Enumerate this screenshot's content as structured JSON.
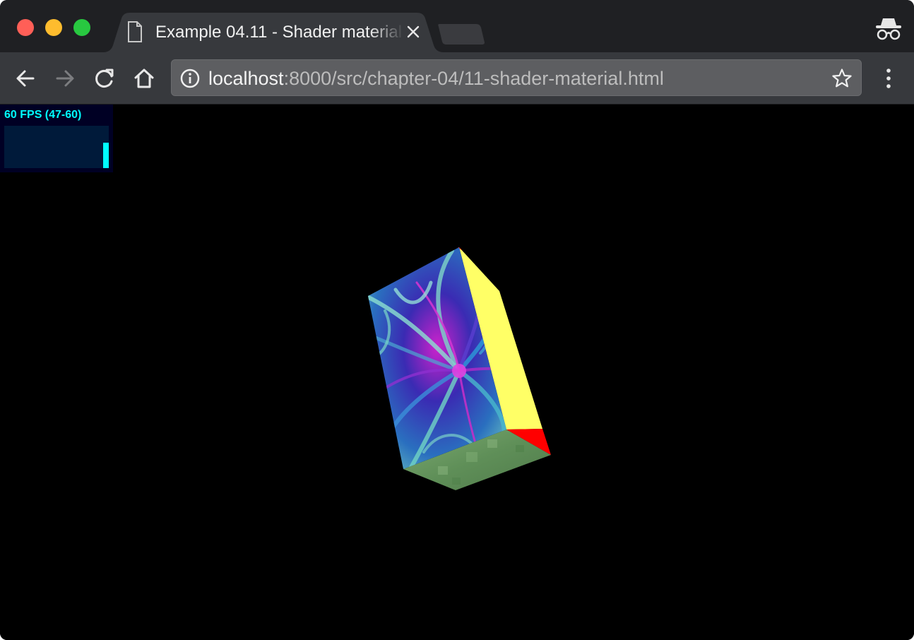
{
  "window": {
    "tab": {
      "title": "Example 04.11 - Shader material",
      "close_icon": "close-icon",
      "doc_icon": "document-icon"
    },
    "incognito_icon": "incognito-icon"
  },
  "toolbar": {
    "back_icon": "arrow-left-icon",
    "forward_icon": "arrow-right-icon",
    "reload_icon": "reload-icon",
    "home_icon": "home-icon",
    "omnibox": {
      "info_icon": "info-icon",
      "url_host": "localhost",
      "url_rest": ":8000/src/chapter-04/11-shader-material.html",
      "bookmark_icon": "star-icon"
    },
    "menu_icon": "three-dots-vertical-icon"
  },
  "stats": {
    "label": "60 FPS (47-60)",
    "fps_level": 0.6,
    "color": "#00ffff"
  },
  "scene": {
    "object": "rotating-box",
    "colors": {
      "background": "#000000",
      "side_face": "#ffff66",
      "corner": "#ff0000",
      "bottom_face": "#6a9a5e"
    }
  }
}
